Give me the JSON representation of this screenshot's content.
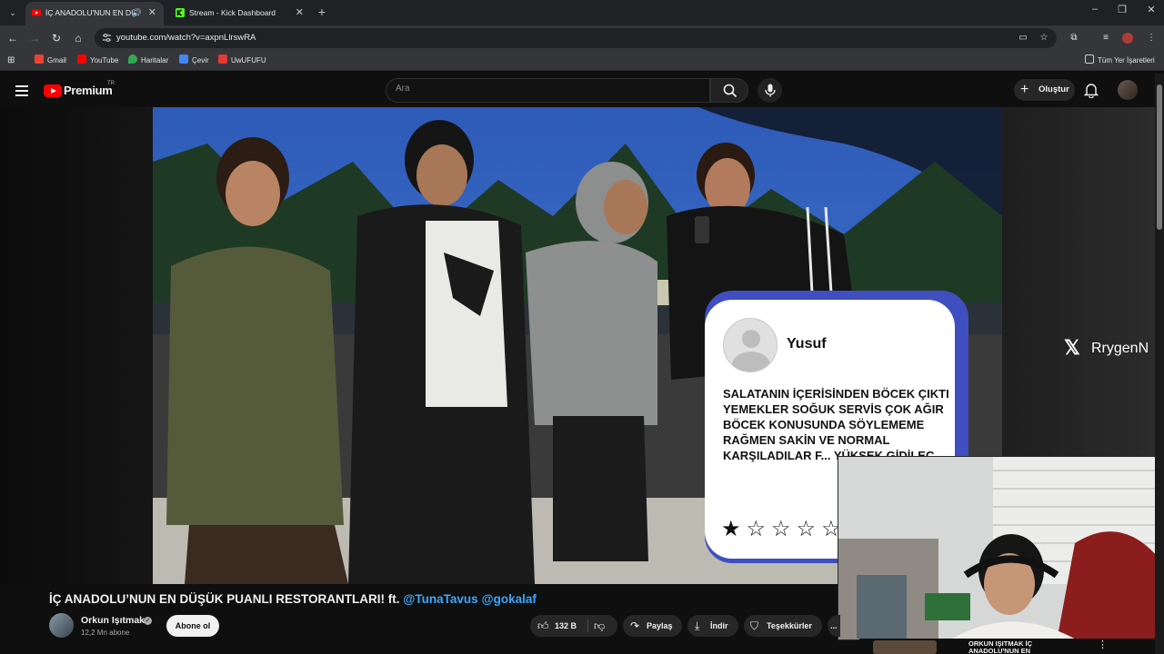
{
  "browser": {
    "tabs": [
      {
        "title": "İÇ ANADOLU'NUN EN DÜŞ",
        "active": true,
        "favicon": "youtube-icon",
        "audio": true
      },
      {
        "title": "Stream - Kick Dashboard",
        "active": false,
        "favicon": "kick-icon",
        "audio": false
      }
    ],
    "url": "youtube.com/watch?v=axpnLlrswRA",
    "bookmarks": [
      {
        "label": "Gmail",
        "icon": "gmail-icon",
        "color": "#ea4335"
      },
      {
        "label": "YouTube",
        "icon": "youtube-icon",
        "color": "#ff0000"
      },
      {
        "label": "Haritalar",
        "icon": "maps-icon",
        "color": "#34a853"
      },
      {
        "label": "Çevir",
        "icon": "translate-icon",
        "color": "#4285f4"
      },
      {
        "label": "UwUFUFU",
        "icon": "uwufufu-icon",
        "color": "#e53935"
      }
    ],
    "all_bookmarks_label": "Tüm Yer İşaretleri"
  },
  "youtube": {
    "logo_text": "Premium",
    "country_code": "TR",
    "search_placeholder": "Ara",
    "create_label": "Oluştur"
  },
  "video": {
    "review": {
      "name": "Yusuf",
      "text": "SALATANIN İÇERİSİNDEN BÖCEK ÇIKTI YEMEKLER SOĞUK SERVİS ÇOK AĞIR BÖCEK KONUSUNDA SÖYLEMEME RAĞMEN SAKİN VE NORMAL KARŞILADILAR F... YÜKSEK GİDİLEC...",
      "stars": "★☆☆☆☆",
      "rating": 1
    },
    "watermark": "RrygenN",
    "title_main": "İÇ ANADOLU’NUN EN DÜŞÜK PUANLI RESTORANTLARI! ft.",
    "title_mentions": "@TunaTavus @gokalaf",
    "channel_name": "Orkun Işıtmak",
    "subscribers": "12,2 Mn abone",
    "subscribe_label": "Abone ol",
    "likes": "132 B",
    "share_label": "Paylaş",
    "download_label": "İndir",
    "thanks_label": "Teşekkürler",
    "more_label": "...",
    "related_title": "ORKUN IŞITMAK İÇ ANADOLU'NUN EN DÜŞÜK"
  },
  "colors": {
    "accent_red": "#ff0000",
    "mention_blue": "#3ea6ff",
    "card_blue": "#3f4fbf"
  }
}
